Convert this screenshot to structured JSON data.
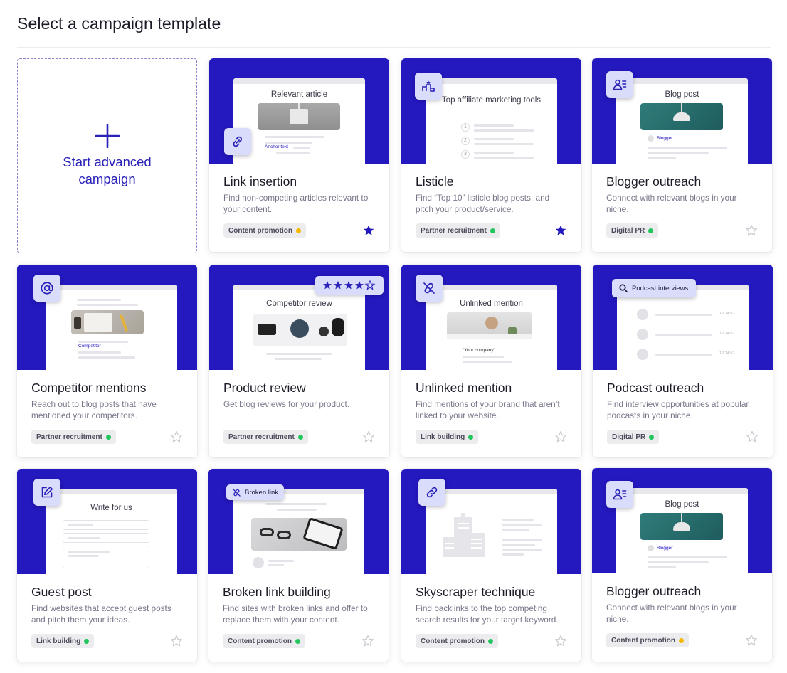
{
  "page_title": "Select a campaign template",
  "advanced": {
    "label": "Start advanced campaign"
  },
  "colors": {
    "brand": "#2418bf",
    "green": "#22c55e",
    "yellow": "#f5b800",
    "star_filled": "#2418bf",
    "star_empty": "#c9c9d1"
  },
  "cards": [
    {
      "title": "Link insertion",
      "desc": "Find non-competing articles relevant to your content.",
      "tag": "Content promotion",
      "tag_dot": "yellow",
      "starred": true,
      "icon": "unlink-chain-icon",
      "mock": {
        "heading": "Relevant article",
        "caption": "Anchor text"
      }
    },
    {
      "title": "Listicle",
      "desc": "Find “Top 10” listicle blog posts, and pitch your product/service.",
      "tag": "Partner recruitment",
      "tag_dot": "green",
      "starred": true,
      "icon": "podium-icon",
      "mock": {
        "heading": "Top affiliate marketing tools",
        "nums": [
          "1",
          "2",
          "3"
        ]
      }
    },
    {
      "title": "Blogger outreach",
      "desc": "Connect with relevant blogs in your niche.",
      "tag": "Digital PR",
      "tag_dot": "green",
      "starred": false,
      "icon": "user-profile-icon",
      "mock": {
        "heading": "Blog post",
        "caption": "Blogger"
      }
    },
    {
      "title": "Competitor mentions",
      "desc": "Reach out to blog posts that have mentioned your competitors.",
      "tag": "Partner recruitment",
      "tag_dot": "green",
      "starred": false,
      "icon": "at-sign-icon",
      "mock": {
        "caption": "Competitor"
      }
    },
    {
      "title": "Product review",
      "desc": "Get blog reviews for your product.",
      "tag": "Partner recruitment",
      "tag_dot": "green",
      "starred": false,
      "icon": "rating-stars-icon",
      "mock": {
        "heading": "Competitor review",
        "rating": 4
      }
    },
    {
      "title": "Unlinked mention",
      "desc": "Find mentions of your brand that aren’t linked to your website.",
      "tag": "Link building",
      "tag_dot": "green",
      "starred": false,
      "icon": "broken-link-icon",
      "mock": {
        "heading": "Unlinked mention",
        "caption": "\"Your company\""
      }
    },
    {
      "title": "Podcast outreach",
      "desc": "Find interview opportunities at popular podcasts in your niche.",
      "tag": "Digital PR",
      "tag_dot": "green",
      "starred": false,
      "icon": "search-icon",
      "mock": {
        "pill": "Podcast interviews",
        "times": [
          "12:24:57",
          "12:24:57",
          "12:24:57"
        ]
      }
    },
    {
      "title": "Guest post",
      "desc": "Find websites that accept guest posts and pitch them your ideas.",
      "tag": "Link building",
      "tag_dot": "green",
      "starred": false,
      "icon": "edit-icon",
      "mock": {
        "heading": "Write for us"
      }
    },
    {
      "title": "Broken link building",
      "desc": "Find sites with broken links and offer to replace them with your content.",
      "tag": "Content promotion",
      "tag_dot": "green",
      "starred": false,
      "icon": "broken-link-icon",
      "mock": {
        "pill": "Broken link"
      }
    },
    {
      "title": "Skyscraper technique",
      "desc": "Find backlinks to the top competing search results for your target keyword.",
      "tag": "Content promotion",
      "tag_dot": "green",
      "starred": false,
      "icon": "link-icon",
      "mock": {}
    },
    {
      "title": "Blogger outreach",
      "desc": "Connect with relevant blogs in your niche.",
      "tag": "Content promotion",
      "tag_dot": "yellow",
      "starred": false,
      "icon": "user-profile-icon",
      "mock": {
        "heading": "Blog post",
        "caption": "Blogger"
      }
    }
  ]
}
